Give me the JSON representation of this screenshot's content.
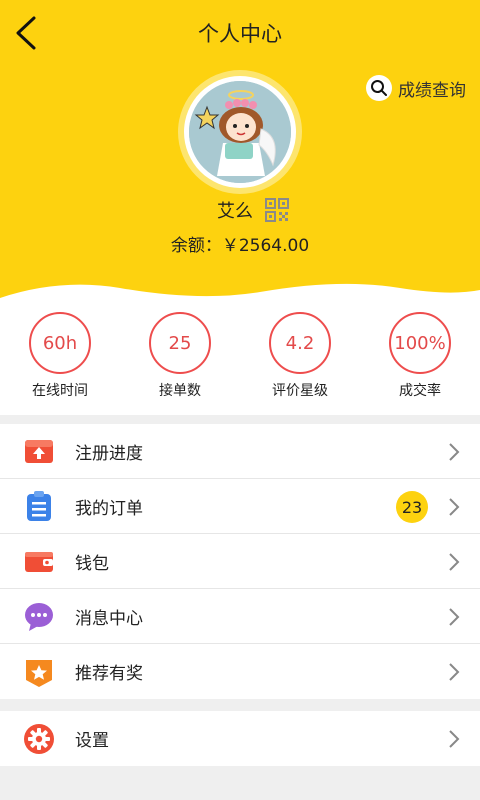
{
  "header": {
    "title": "个人中心",
    "back_icon": "back-chevron-icon",
    "query_label": "成绩查询",
    "query_icon": "search-icon",
    "bg_color": "#fdd20f"
  },
  "profile": {
    "name": "艾么",
    "qr_icon": "qr-code-icon",
    "balance_text": "余额：￥2564.00"
  },
  "stats": [
    {
      "value": "60h",
      "label": "在线时间"
    },
    {
      "value": "25",
      "label": "接单数"
    },
    {
      "value": "4.2",
      "label": "评价星级"
    },
    {
      "value": "100%",
      "label": "成交率"
    }
  ],
  "menu": {
    "items": [
      {
        "label": "注册进度",
        "icon": "upload-box-icon",
        "color": "#f04e36"
      },
      {
        "label": "我的订单",
        "icon": "clipboard-list-icon",
        "color": "#3c82e8",
        "badge": "23"
      },
      {
        "label": "钱包",
        "icon": "wallet-icon",
        "color": "#f04e36"
      },
      {
        "label": "消息中心",
        "icon": "chat-bubble-icon",
        "color": "#9b5fd6"
      },
      {
        "label": "推荐有奖",
        "icon": "star-badge-icon",
        "color": "#f5891f"
      }
    ],
    "settings": {
      "label": "设置",
      "icon": "gear-icon",
      "color": "#f04e36"
    }
  }
}
